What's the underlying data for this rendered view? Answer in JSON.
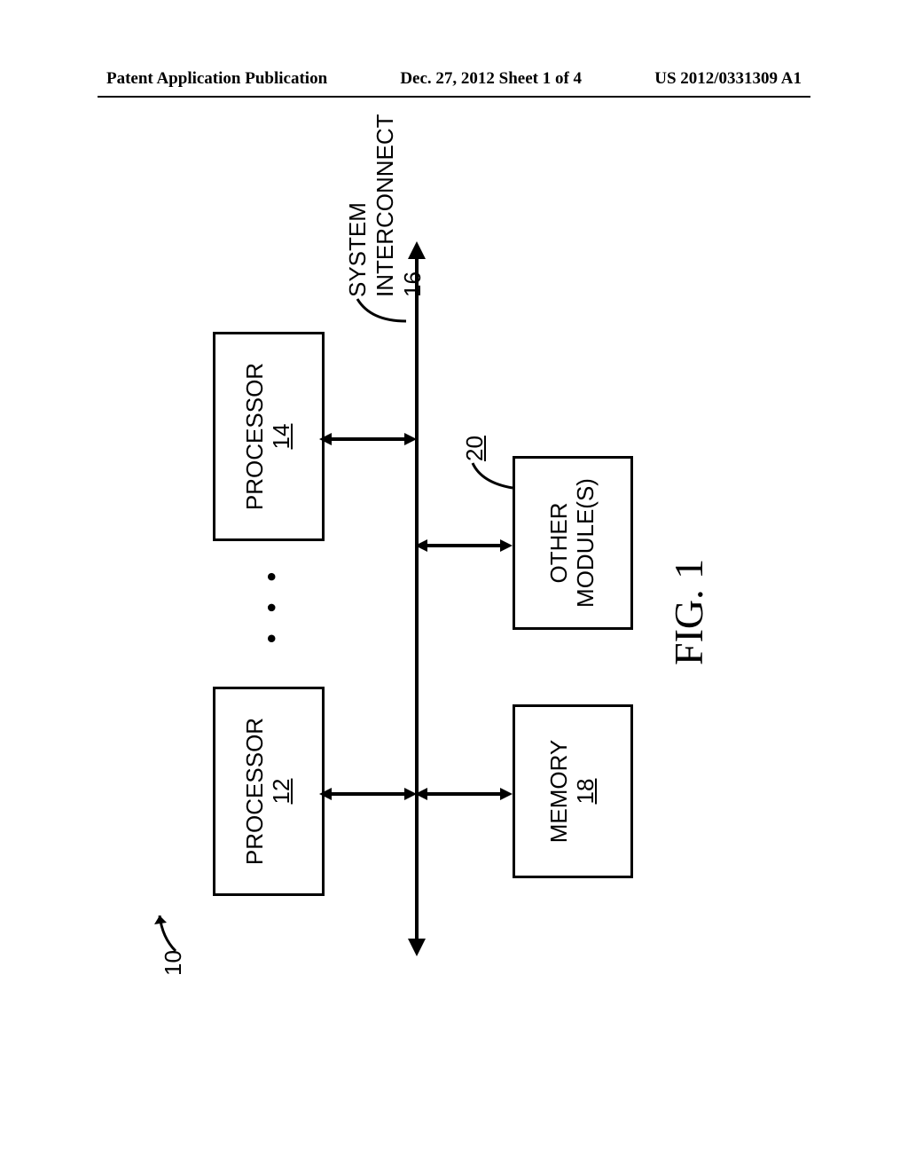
{
  "header": {
    "left": "Patent Application Publication",
    "center": "Dec. 27, 2012  Sheet 1 of 4",
    "right": "US 2012/0331309 A1"
  },
  "diagram": {
    "system_ref": "10",
    "processor_a": {
      "title": "PROCESSOR",
      "ref": "12"
    },
    "processor_b": {
      "title": "PROCESSOR",
      "ref": "14"
    },
    "memory": {
      "title": "MEMORY",
      "ref": "18"
    },
    "other": {
      "title": "OTHER\nMODULE(S)",
      "ref": "20"
    },
    "other_line1": "OTHER",
    "other_line2": "MODULE(S)",
    "ellipsis": "• • •",
    "interconnect_label": "SYSTEM INTERCONNECT 16"
  },
  "figure_label": "FIG. 1"
}
